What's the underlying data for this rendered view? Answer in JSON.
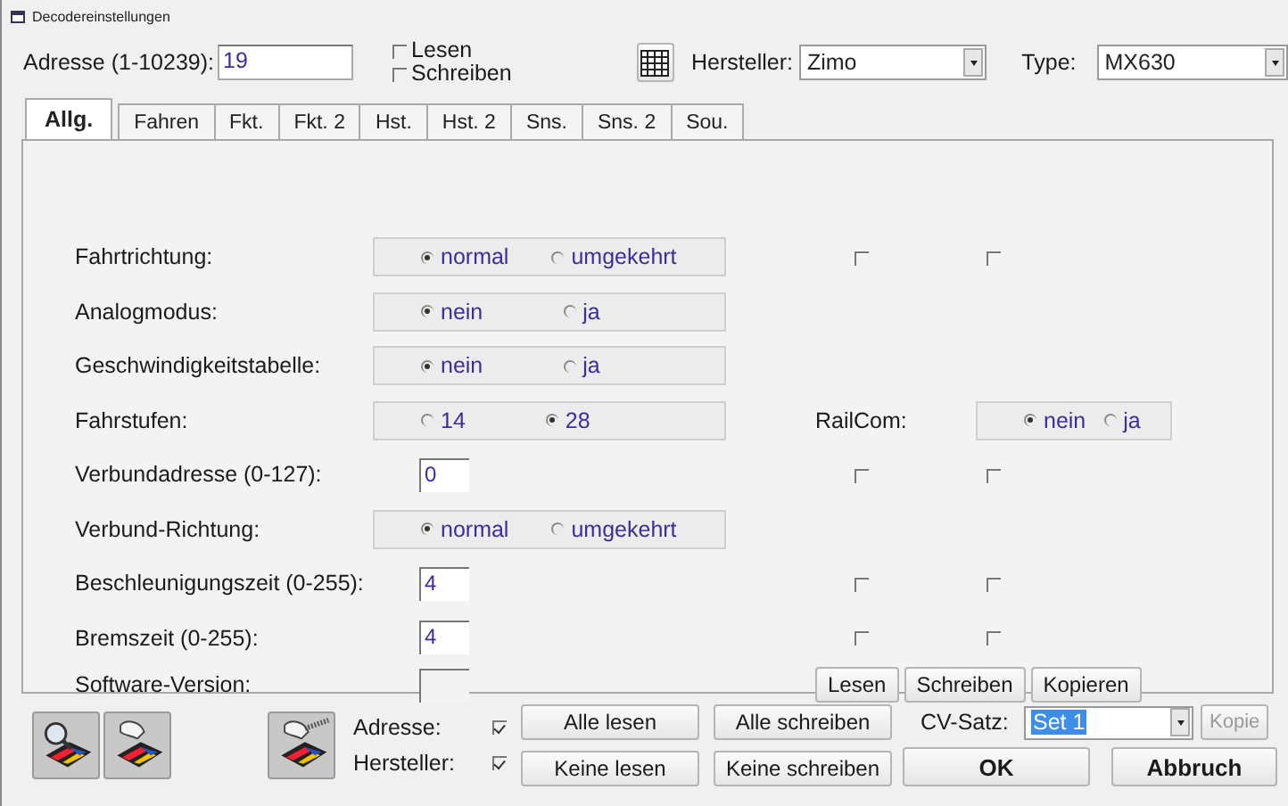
{
  "window": {
    "title": "Decodereinstellungen"
  },
  "header": {
    "address_label": "Adresse (1-10239):",
    "address": "19",
    "options": [
      {
        "label": "Lesen",
        "checked": false
      },
      {
        "label": "Schreiben",
        "checked": false
      }
    ],
    "manufacturer_label": "Hersteller:",
    "manufacturer": "Zimo",
    "type_label": "Type:",
    "type": "MX630"
  },
  "tabs": [
    {
      "label": "Allg.",
      "selected": true
    },
    {
      "label": "Fahren",
      "selected": false
    },
    {
      "label": "Fkt.",
      "selected": false
    },
    {
      "label": "Fkt. 2",
      "selected": false
    },
    {
      "label": "Hst.",
      "selected": false
    },
    {
      "label": "Hst. 2",
      "selected": false
    },
    {
      "label": "Sns.",
      "selected": false
    },
    {
      "label": "Sns. 2",
      "selected": false
    },
    {
      "label": "Sou.",
      "selected": false
    }
  ],
  "rows": [
    {
      "kind": "radio",
      "label": "Fahrtrichtung:",
      "options": [
        {
          "label": "normal",
          "selected": true
        },
        {
          "label": "umgekehrt",
          "selected": false
        }
      ],
      "flags": [
        {
          "checked": false
        },
        {
          "checked": false
        }
      ]
    },
    {
      "kind": "radio",
      "label": "Analogmodus:",
      "options": [
        {
          "label": "nein",
          "selected": true
        },
        {
          "label": "ja",
          "selected": false
        }
      ]
    },
    {
      "kind": "radio",
      "label": "Geschwindigkeitstabelle:",
      "options": [
        {
          "label": "nein",
          "selected": true
        },
        {
          "label": "ja",
          "selected": false
        }
      ]
    },
    {
      "kind": "radio",
      "label": "Fahrstufen:",
      "options": [
        {
          "label": "14",
          "selected": false
        },
        {
          "label": "28",
          "selected": true
        }
      ],
      "railcom": {
        "label": "RailCom:",
        "options": [
          {
            "label": "nein",
            "selected": true
          },
          {
            "label": "ja",
            "selected": false
          }
        ]
      }
    },
    {
      "kind": "input",
      "label": "Verbundadresse (0-127):",
      "value": "0",
      "flags": [
        {
          "checked": false
        },
        {
          "checked": false
        }
      ]
    },
    {
      "kind": "radio",
      "label": "Verbund-Richtung:",
      "options": [
        {
          "label": "normal",
          "selected": true
        },
        {
          "label": "umgekehrt",
          "selected": false
        }
      ]
    },
    {
      "kind": "input",
      "label": "Beschleunigungszeit (0-255):",
      "value": "4",
      "flags": [
        {
          "checked": false
        },
        {
          "checked": false
        }
      ]
    },
    {
      "kind": "input",
      "label": "Bremszeit (0-255):",
      "value": "4",
      "flags": [
        {
          "checked": false
        },
        {
          "checked": false
        }
      ]
    },
    {
      "kind": "readonly",
      "label": "Software-Version:"
    }
  ],
  "row_buttons": [
    "Lesen",
    "Schreiben",
    "Kopieren"
  ],
  "footer": {
    "options": [
      {
        "label": "Adresse:",
        "checked": true
      },
      {
        "label": "Hersteller:",
        "checked": true
      }
    ],
    "read_buttons": [
      "Alle lesen",
      "Keine lesen"
    ],
    "write_buttons": [
      "Alle schreiben",
      "Keine schreiben"
    ],
    "cv_set_label": "CV-Satz:",
    "cv_set": "Set 1",
    "copy_button": {
      "label": "Kopie",
      "disabled": true
    },
    "ok": "OK",
    "cancel": "Abbruch"
  }
}
